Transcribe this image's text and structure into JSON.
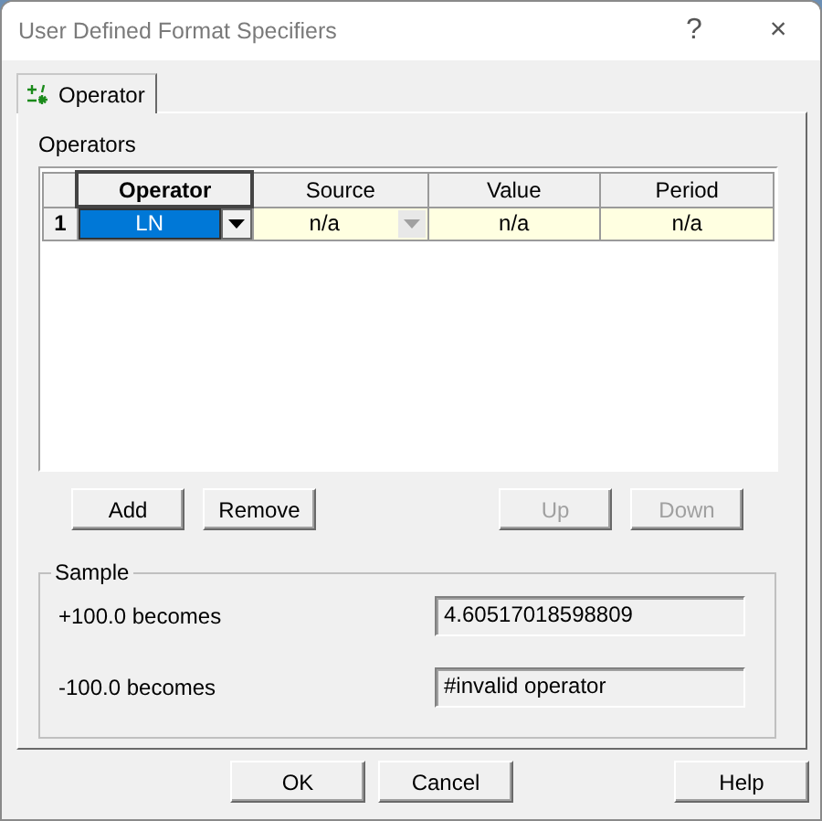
{
  "window": {
    "title": "User Defined Format Specifiers",
    "help_glyph": "?",
    "close_glyph": "×"
  },
  "tabs": [
    {
      "label": "Operator",
      "selected": true
    }
  ],
  "operators": {
    "label": "Operators",
    "columns": [
      "Operator",
      "Source",
      "Value",
      "Period"
    ],
    "rows": [
      {
        "number": "1",
        "cells": [
          {
            "kind": "combo",
            "text": "LN",
            "selected": true,
            "disabled": false
          },
          {
            "kind": "combo",
            "text": "n/a",
            "selected": false,
            "disabled": true
          },
          {
            "kind": "text",
            "text": "n/a",
            "selected": false
          },
          {
            "kind": "text",
            "text": "n/a",
            "selected": false
          }
        ]
      }
    ]
  },
  "list_buttons": [
    {
      "label": "Add",
      "disabled": false
    },
    {
      "label": "Remove",
      "disabled": false
    },
    {
      "label": "Up",
      "disabled": true
    },
    {
      "label": "Down",
      "disabled": true
    }
  ],
  "sample": {
    "label": "Sample",
    "rows": [
      {
        "label": "+100.0 becomes",
        "value": "4.60517018598809"
      },
      {
        "label": "-100.0 becomes",
        "value": "#invalid operator"
      }
    ]
  },
  "dialog_buttons": [
    {
      "label": "OK"
    },
    {
      "label": "Cancel"
    },
    {
      "label": "Help"
    }
  ]
}
